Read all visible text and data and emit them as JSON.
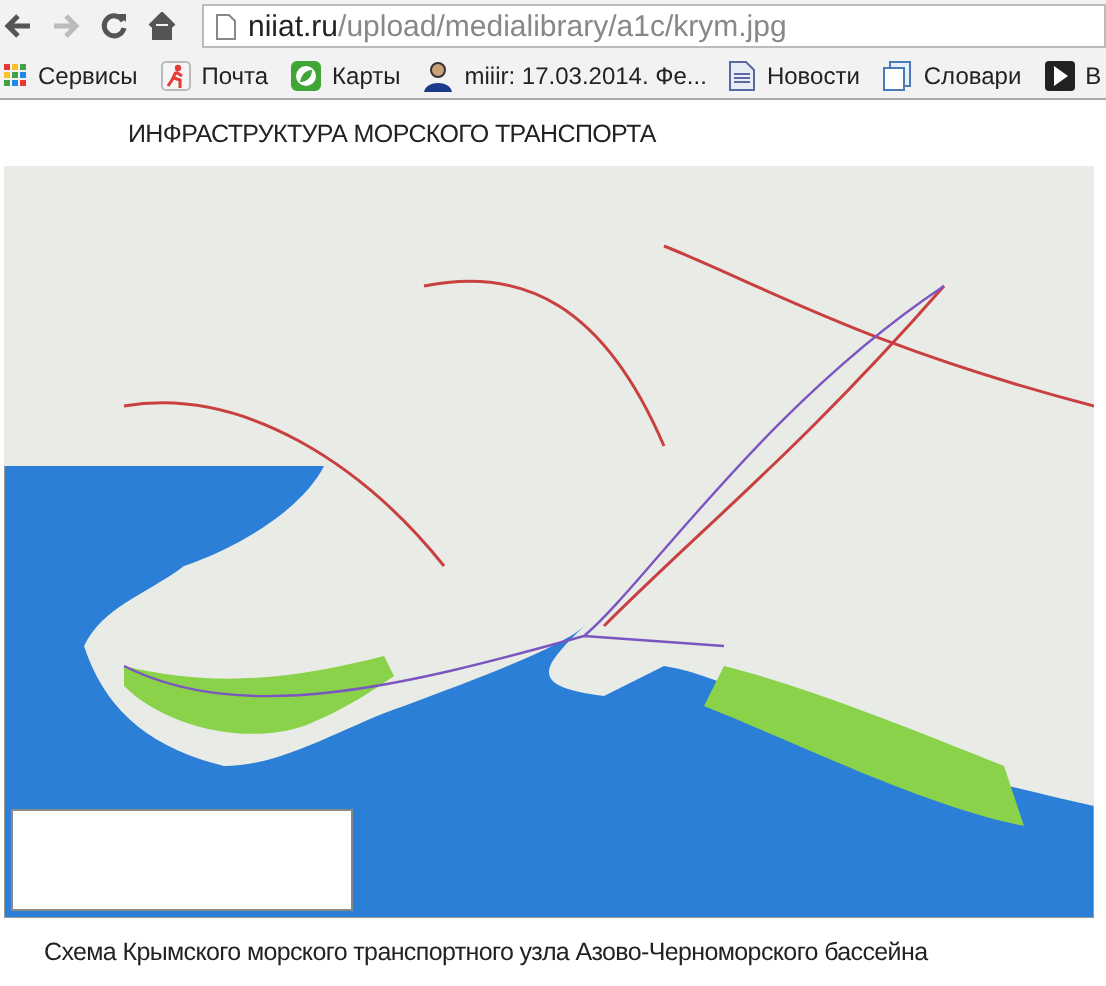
{
  "toolbar": {
    "url_domain": "niiat.ru",
    "url_path": "/upload/medialibrary/a1c/krym.jpg"
  },
  "bookmarks": [
    {
      "label": "Сервисы",
      "kind": "apps"
    },
    {
      "label": "Почта",
      "kind": "mail"
    },
    {
      "label": "Карты",
      "kind": "maps"
    },
    {
      "label": "miiir: 17.03.2014. Фе...",
      "kind": "user"
    },
    {
      "label": "Новости",
      "kind": "doc"
    },
    {
      "label": "Словари",
      "kind": "dict"
    },
    {
      "label": "В",
      "kind": "play"
    }
  ],
  "image": {
    "title": "ИНФРАСТРУКТУРА МОРСКОГО ТРАНСПОРТА",
    "caption": "Схема Крымского морского транспортного узла Азово-Черноморского бассейна"
  }
}
